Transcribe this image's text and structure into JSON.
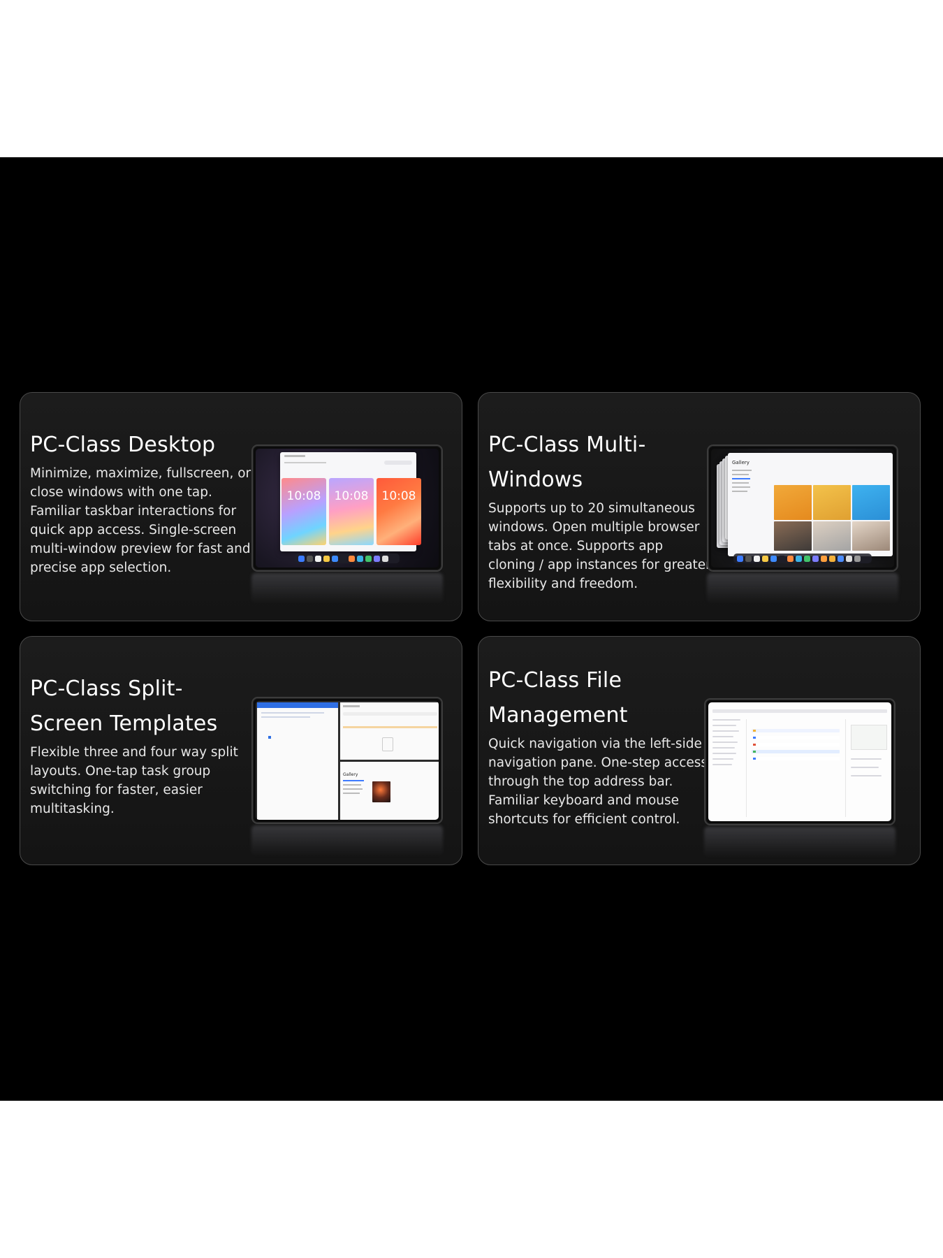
{
  "cards": [
    {
      "title": "PC-Class Desktop",
      "description": "Minimize, maximize, fullscreen, or close windows with one tap. Familiar taskbar interactions for quick app access. Single-screen multi-window preview for fast and precise app selection.",
      "screen_clock": "10:08"
    },
    {
      "title": "PC-Class Multi-Windows",
      "description": "Supports up to 20 simultaneous windows. Open multiple browser tabs at once. Supports app cloning / app instances for greater flexibility and freedom.",
      "screen_app": "Gallery"
    },
    {
      "title": "PC-Class Split-Screen Templates",
      "description": "Flexible three and four way split layouts. One-tap task group switching for faster, easier multitasking.",
      "screen_app": "Gallery"
    },
    {
      "title": "PC-Class File Management",
      "description": "Quick navigation via the left-side navigation pane. One-step access through the top address bar. Familiar keyboard and mouse shortcuts for efficient control."
    }
  ],
  "colors": {
    "page": "#ffffff",
    "band": "#000000",
    "card_border": "#4a4a4a",
    "title": "#ffffff",
    "body": "#e8e8e8"
  }
}
